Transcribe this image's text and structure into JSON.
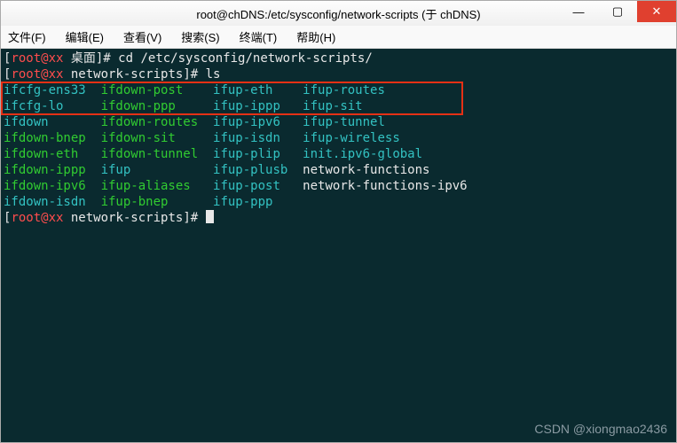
{
  "titlebar": {
    "title": "root@chDNS:/etc/sysconfig/network-scripts (于 chDNS)"
  },
  "win": {
    "min": "—",
    "max": "▢",
    "close": "✕"
  },
  "menu": {
    "file": "文件(F)",
    "edit": "编辑(E)",
    "view": "查看(V)",
    "search": "搜索(S)",
    "term": "终端(T)",
    "help": "帮助(H)"
  },
  "prompt": {
    "l1a": "[",
    "l1b": "root@xx ",
    "l1c": "桌面",
    "l1d": "]# ",
    "cmd1": "cd /etc/sysconfig/network-scripts/",
    "l2a": "[",
    "l2b": "root@xx ",
    "l2c": "network-scripts",
    "l2d": "]# ",
    "cmd2": "ls",
    "l3a": "[",
    "l3b": "root@xx ",
    "l3c": "network-scripts",
    "l3d": "]# "
  },
  "listing": [
    [
      {
        "t": "ifcfg-ens33",
        "c": "cyan",
        "w": 13
      },
      {
        "t": "ifdown-post",
        "c": "green",
        "w": 15
      },
      {
        "t": "ifup-eth",
        "c": "cyan",
        "w": 12
      },
      {
        "t": "ifup-routes",
        "c": "cyan",
        "w": 0
      }
    ],
    [
      {
        "t": "ifcfg-lo",
        "c": "cyan",
        "w": 13
      },
      {
        "t": "ifdown-ppp",
        "c": "green",
        "w": 15
      },
      {
        "t": "ifup-ippp",
        "c": "cyan",
        "w": 12
      },
      {
        "t": "ifup-sit",
        "c": "cyan",
        "w": 0
      }
    ],
    [
      {
        "t": "ifdown",
        "c": "cyan",
        "w": 13
      },
      {
        "t": "ifdown-routes",
        "c": "green",
        "w": 15
      },
      {
        "t": "ifup-ipv6",
        "c": "cyan",
        "w": 12
      },
      {
        "t": "ifup-tunnel",
        "c": "cyan",
        "w": 0
      }
    ],
    [
      {
        "t": "ifdown-bnep",
        "c": "green",
        "w": 13
      },
      {
        "t": "ifdown-sit",
        "c": "green",
        "w": 15
      },
      {
        "t": "ifup-isdn",
        "c": "cyan",
        "w": 12
      },
      {
        "t": "ifup-wireless",
        "c": "cyan",
        "w": 0
      }
    ],
    [
      {
        "t": "ifdown-eth",
        "c": "green",
        "w": 13
      },
      {
        "t": "ifdown-tunnel",
        "c": "green",
        "w": 15
      },
      {
        "t": "ifup-plip",
        "c": "cyan",
        "w": 12
      },
      {
        "t": "init.ipv6-global",
        "c": "cyan",
        "w": 0
      }
    ],
    [
      {
        "t": "ifdown-ippp",
        "c": "green",
        "w": 13
      },
      {
        "t": "ifup",
        "c": "cyan",
        "w": 15
      },
      {
        "t": "ifup-plusb",
        "c": "cyan",
        "w": 12
      },
      {
        "t": "network-functions",
        "c": "white",
        "w": 0
      }
    ],
    [
      {
        "t": "ifdown-ipv6",
        "c": "green",
        "w": 13
      },
      {
        "t": "ifup-aliases",
        "c": "green",
        "w": 15
      },
      {
        "t": "ifup-post",
        "c": "cyan",
        "w": 12
      },
      {
        "t": "network-functions-ipv6",
        "c": "white",
        "w": 0
      }
    ],
    [
      {
        "t": "ifdown-isdn",
        "c": "cyan",
        "w": 13
      },
      {
        "t": "ifup-bnep",
        "c": "green",
        "w": 15
      },
      {
        "t": "ifup-ppp",
        "c": "cyan",
        "w": 12
      }
    ]
  ],
  "watermark": "CSDN @xiongmao2436"
}
